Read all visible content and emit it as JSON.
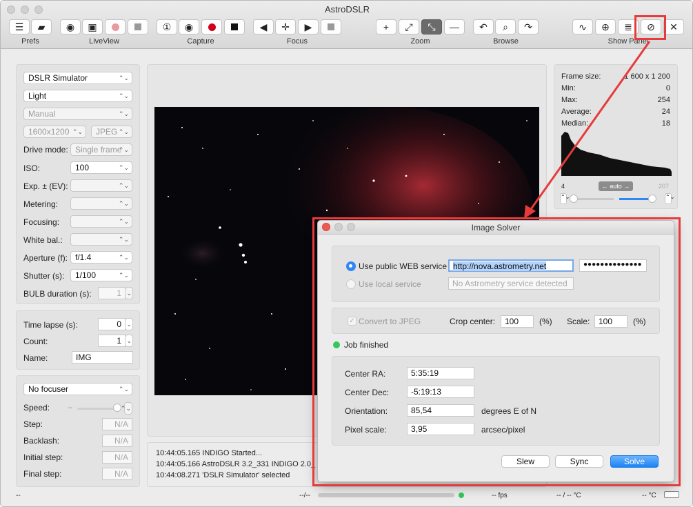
{
  "app": {
    "title": "AstroDSLR"
  },
  "toolbar": {
    "groups": [
      "Prefs",
      "LiveView",
      "Capture",
      "Focus",
      "Zoom",
      "Browse",
      "Show Panel"
    ]
  },
  "left": {
    "device": "DSLR Simulator",
    "frame_type": "Light",
    "mode": "Manual",
    "resolution": "1600x1200",
    "format": "JPEG",
    "drive_mode_label": "Drive mode:",
    "drive_mode": "Single frame",
    "iso_label": "ISO:",
    "iso": "100",
    "exp_label": "Exp. ± (EV):",
    "metering_label": "Metering:",
    "focusing_label": "Focusing:",
    "white_bal_label": "White bal.:",
    "aperture_label": "Aperture (f):",
    "aperture": "f/1.4",
    "shutter_label": "Shutter (s):",
    "shutter": "1/100",
    "bulb_label": "BULB duration (s):",
    "bulb": "1",
    "timelapse_label": "Time lapse (s):",
    "timelapse": "0",
    "count_label": "Count:",
    "count": "1",
    "name_label": "Name:",
    "name": "IMG",
    "focuser": "No focuser",
    "speed_label": "Speed:",
    "speed": "--",
    "step_label": "Step:",
    "step": "N/A",
    "backlash_label": "Backlash:",
    "backlash": "N/A",
    "initial_step_label": "Initial step:",
    "initial_step": "N/A",
    "final_step_label": "Final step:",
    "final_step": "N/A"
  },
  "stats": {
    "frame_size_label": "Frame size:",
    "frame_size": "1 600 x 1 200",
    "min_label": "Min:",
    "min": "0",
    "max_label": "Max:",
    "max": "254",
    "average_label": "Average:",
    "average": "24",
    "median_label": "Median:",
    "median": "18",
    "hist_low": "4",
    "hist_high": "207",
    "auto_label": "← auto →"
  },
  "log": [
    "10:44:05.165 INDIGO Started...",
    "10:44:05.166 AstroDSLR 3.2_331 INDIGO 2.0_",
    "10:44:08.271 'DSLR Simulator' selected"
  ],
  "status": {
    "left": "--",
    "progress": "--/--",
    "fps": "-- fps",
    "temp": "-- / -- °C",
    "temp2": "-- °C"
  },
  "dialog": {
    "title": "Image Solver",
    "public_label": "Use public WEB service",
    "public_url": "http://nova.astrometry.net",
    "api_key": "●●●●●●●●●●●●●●",
    "local_label": "Use local service",
    "local_placeholder": "No Astrometry service detected",
    "convert_label": "Convert to JPEG",
    "crop_label": "Crop center:",
    "crop": "100",
    "crop_unit": "(%)",
    "scale_label": "Scale:",
    "scale": "100",
    "scale_unit": "(%)",
    "job_status": "Job finished",
    "ra_label": "Center RA:",
    "ra": "5:35:19",
    "dec_label": "Center Dec:",
    "dec": "-5:19:13",
    "orient_label": "Orientation:",
    "orient": "85,54",
    "orient_unit": "degrees E of N",
    "pixscale_label": "Pixel scale:",
    "pixscale": "3,95",
    "pixscale_unit": "arcsec/pixel",
    "slew": "Slew",
    "sync": "Sync",
    "solve": "Solve"
  }
}
